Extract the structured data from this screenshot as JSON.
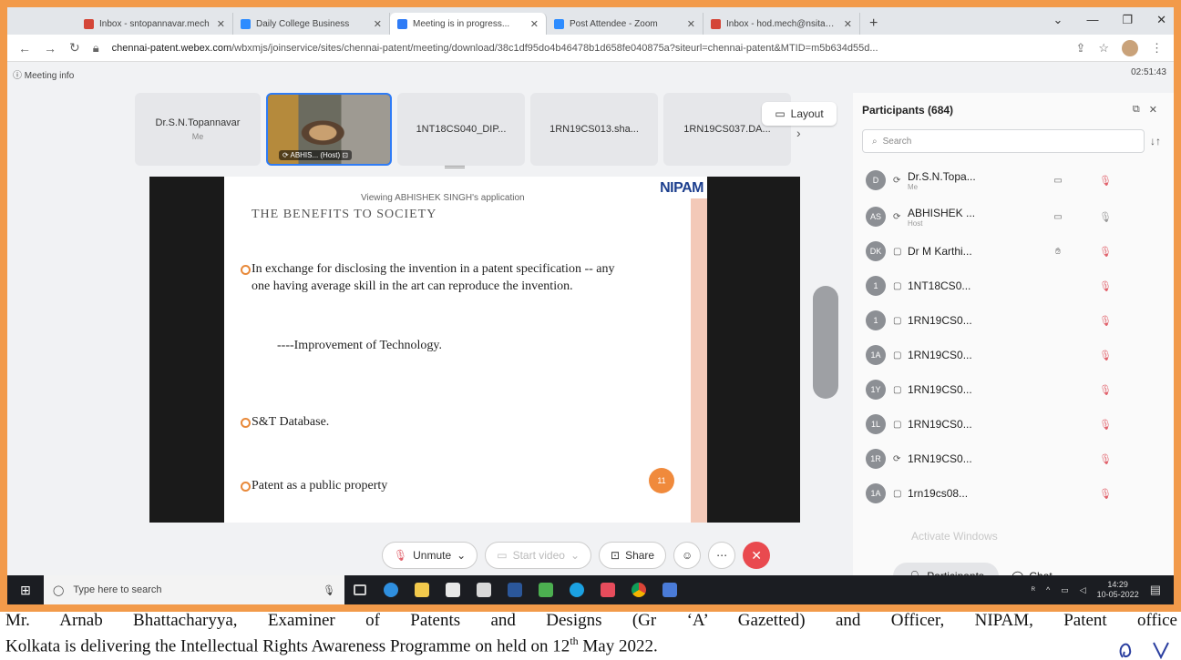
{
  "browser": {
    "tabs": [
      {
        "label": "Inbox - sntopannavar.mech",
        "icon_color": "#d44638"
      },
      {
        "label": "Daily College Business",
        "icon_color": "#2d8cff"
      },
      {
        "label": "Meeting is in progress...",
        "icon_color": "#2f7cf6"
      },
      {
        "label": "Post Attendee - Zoom",
        "icon_color": "#2d8cff"
      },
      {
        "label": "Inbox - hod.mech@nsitac.in",
        "icon_color": "#d44638"
      }
    ],
    "url_domain": "chennai-patent.webex.com",
    "url_path": "/wbxmjs/joinservice/sites/chennai-patent/meeting/download/38c1df95do4b46478b1d658fe040875a?siteurl=chennai-patent&MTID=m5b634d55d..."
  },
  "meeting": {
    "info_label": "Meeting info",
    "clock": "02:51:43",
    "self_name": "Dr.S.N.Topannavar",
    "self_sub": "Me",
    "host_label": "ABHIS... (Host)",
    "strip": [
      "1NT18CS040_DIP...",
      "1RN19CS013.sha...",
      "1RN19CS037.DA..."
    ],
    "layout_label": "Layout",
    "viewing_text": "Viewing ABHISHEK SINGH's application",
    "controls": {
      "unmute": "Unmute",
      "start_video": "Start video",
      "share": "Share"
    }
  },
  "slide": {
    "logo": "NIPAM",
    "title": "THE BENEFITS TO SOCIETY",
    "bullet1": "In exchange for disclosing the invention in a patent specification -- any one having average skill in the art can reproduce the invention.",
    "improvement": "----Improvement of Technology.",
    "bullet2": "S&T Database.",
    "bullet3": "Patent as a public property",
    "counter": "11"
  },
  "participants": {
    "title": "Participants (684)",
    "search_placeholder": "Search",
    "rows": [
      {
        "initials": "D",
        "name": "Dr.S.N.Topa...",
        "sub": "Me"
      },
      {
        "initials": "AS",
        "name": "ABHISHEK ...",
        "sub": "Host"
      },
      {
        "initials": "DK",
        "name": "Dr M Karthi...",
        "sub": ""
      },
      {
        "initials": "1",
        "name": "1NT18CS0...",
        "sub": ""
      },
      {
        "initials": "1",
        "name": "1RN19CS0...",
        "sub": ""
      },
      {
        "initials": "1A",
        "name": "1RN19CS0...",
        "sub": ""
      },
      {
        "initials": "1Y",
        "name": "1RN19CS0...",
        "sub": ""
      },
      {
        "initials": "1L",
        "name": "1RN19CS0...",
        "sub": ""
      },
      {
        "initials": "1R",
        "name": "1RN19CS0...",
        "sub": ""
      },
      {
        "initials": "1A",
        "name": "1rn19cs08...",
        "sub": ""
      }
    ],
    "watermark": "Activate Windows",
    "tab_participants": "Participants",
    "tab_chat": "Chat"
  },
  "taskbar": {
    "search_placeholder": "Type here to search",
    "time": "14:29",
    "date": "10-05-2022"
  },
  "caption": {
    "line1": "Mr. Arnab Bhattacharyya, Examiner of Patents and Designs (Gr ‘A’ Gazetted) and Officer, NIPAM, Patent office",
    "line2_pre": "Kolkata is delivering the Intellectual Rights Awareness Programme on held on 12",
    "line2_sup": "th",
    "line2_post": " May  2022."
  },
  "colors": {
    "frame": "#f29a4a",
    "accent": "#2f7cf6",
    "leave": "#e94a4f",
    "mic_muted": "#e0606a"
  }
}
